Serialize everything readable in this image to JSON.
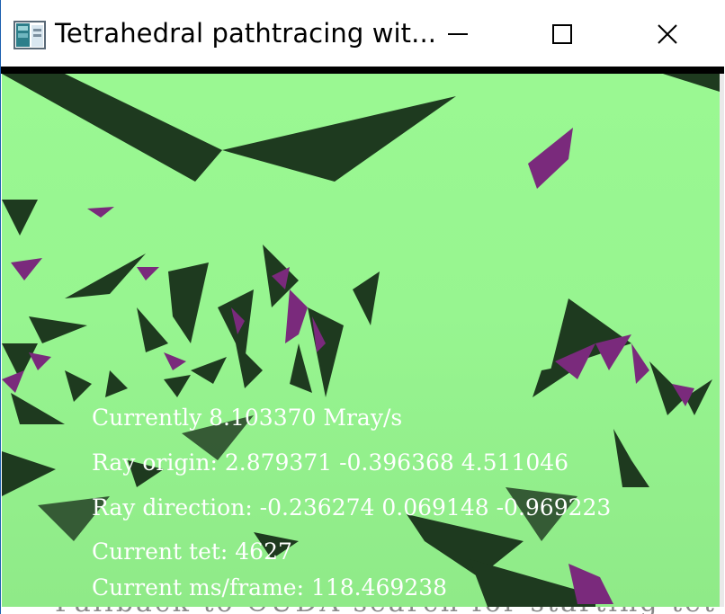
{
  "window": {
    "title": "Tetrahedral pathtracing wit...",
    "icon": "app-window-icon",
    "controls": [
      "minimize-icon",
      "maximize-icon",
      "close-icon"
    ]
  },
  "viewport": {
    "background": "#9af892",
    "shard_dark": "#1e3a1f",
    "shard_purple": "#7a2a7c"
  },
  "overlay": {
    "rate": "Currently 8.103370 Mray/s",
    "ray_origin": "Ray origin: 2.879371 -0.396368 4.511046",
    "ray_direction": "Ray direction: -0.236274 0.069148 -0.969223",
    "current_tet": "Current tet: 4627",
    "ms_frame": "Current ms/frame: 118.469238"
  },
  "background_window": {
    "text": "Fallback to CUDA search for starting tet"
  }
}
